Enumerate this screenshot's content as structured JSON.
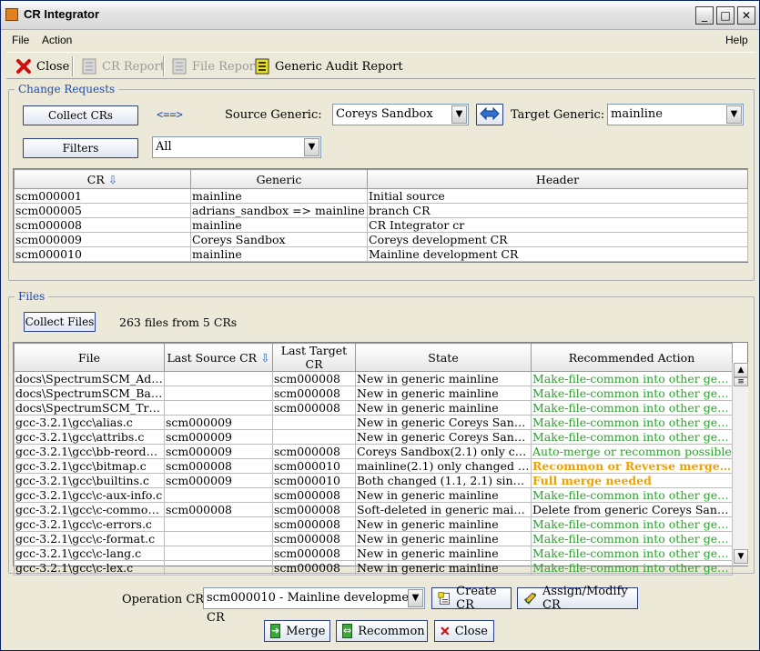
{
  "window": {
    "title": "CR Integrator"
  },
  "menu": {
    "file": "File",
    "action": "Action",
    "help": "Help"
  },
  "toolbar": {
    "close": "Close",
    "cr_report": "CR Report",
    "file_report": "File Report",
    "generic_audit": "Generic Audit Report"
  },
  "change_requests": {
    "legend": "Change Requests",
    "collect_btn": "Collect CRs",
    "arrows": "<==>",
    "source_label": "Source Generic:",
    "source_value": "Coreys Sandbox",
    "target_label": "Target Generic:",
    "target_value": "mainline",
    "filters_btn": "Filters",
    "filter_value": "All",
    "columns": [
      "CR",
      "Generic",
      "Header"
    ],
    "rows": [
      [
        "scm000001",
        "mainline",
        "Initial source"
      ],
      [
        "scm000005",
        "adrians_sandbox => mainline",
        "branch CR"
      ],
      [
        "scm000008",
        "mainline",
        "CR Integrator cr"
      ],
      [
        "scm000009",
        "Coreys Sandbox",
        "Coreys development CR"
      ],
      [
        "scm000010",
        "mainline",
        "Mainline development CR"
      ]
    ]
  },
  "files": {
    "legend": "Files",
    "collect_btn": "Collect Files",
    "summary": "263 files from 5 CRs",
    "columns": [
      "File",
      "Last Source CR",
      "Last Target CR",
      "State",
      "Recommended Action"
    ],
    "rows": [
      {
        "file": "docs\\SpectrumSCM_Adva...",
        "src": "",
        "tgt": "scm000008",
        "state": "New in generic mainline",
        "action": "Make-file-common into other generic",
        "color": "green"
      },
      {
        "file": "docs\\SpectrumSCM_Basic...",
        "src": "",
        "tgt": "scm000008",
        "state": "New in generic mainline",
        "action": "Make-file-common into other generic",
        "color": "green"
      },
      {
        "file": "docs\\SpectrumSCM_Traini...",
        "src": "",
        "tgt": "scm000008",
        "state": "New in generic mainline",
        "action": "Make-file-common into other generic",
        "color": "green"
      },
      {
        "file": "gcc-3.2.1\\gcc\\alias.c",
        "src": "scm000009",
        "tgt": "",
        "state": "New in generic Coreys Sandbox",
        "action": "Make-file-common into other generic",
        "color": "green"
      },
      {
        "file": "gcc-3.2.1\\gcc\\attribs.c",
        "src": "scm000009",
        "tgt": "",
        "state": "New in generic Coreys Sandbox",
        "action": "Make-file-common into other generic",
        "color": "green"
      },
      {
        "file": "gcc-3.2.1\\gcc\\bb-reorder.c",
        "src": "scm000009",
        "tgt": "scm000008",
        "state": "Coreys Sandbox(2.1) only chang...",
        "action": "Auto-merge or recommon possible",
        "color": "green"
      },
      {
        "file": "gcc-3.2.1\\gcc\\bitmap.c",
        "src": "scm000008",
        "tgt": "scm000010",
        "state": "mainline(2.1) only changed since ...",
        "action": "Recommon or Reverse merge nee...",
        "color": "orange"
      },
      {
        "file": "gcc-3.2.1\\gcc\\builtins.c",
        "src": "scm000009",
        "tgt": "scm000010",
        "state": "Both changed (1.1, 2.1) since 1.0",
        "action": "Full merge needed",
        "color": "orange"
      },
      {
        "file": "gcc-3.2.1\\gcc\\c-aux-info.c",
        "src": "",
        "tgt": "scm000008",
        "state": "New in generic mainline",
        "action": "Make-file-common into other generic",
        "color": "green"
      },
      {
        "file": "gcc-3.2.1\\gcc\\c-common.c",
        "src": "scm000008",
        "tgt": "scm000008",
        "state": "Soft-deleted in generic mainline",
        "action": "Delete from generic Coreys Sandbox",
        "color": "black"
      },
      {
        "file": "gcc-3.2.1\\gcc\\c-errors.c",
        "src": "",
        "tgt": "scm000008",
        "state": "New in generic mainline",
        "action": "Make-file-common into other generic",
        "color": "green"
      },
      {
        "file": "gcc-3.2.1\\gcc\\c-format.c",
        "src": "",
        "tgt": "scm000008",
        "state": "New in generic mainline",
        "action": "Make-file-common into other generic",
        "color": "green"
      },
      {
        "file": "gcc-3.2.1\\gcc\\c-lang.c",
        "src": "",
        "tgt": "scm000008",
        "state": "New in generic mainline",
        "action": "Make-file-common into other generic",
        "color": "green"
      },
      {
        "file": "gcc-3.2.1\\gcc\\c-lex.c",
        "src": "",
        "tgt": "scm000008",
        "state": "New in generic mainline",
        "action": "Make-file-common into other generic",
        "color": "green"
      }
    ]
  },
  "bottom": {
    "operation_label": "Operation CR:",
    "operation_value": "scm000010 - Mainline development CR",
    "create_cr": "Create CR",
    "assign_modify": "Assign/Modify CR",
    "merge": "Merge",
    "recommon": "Recommon",
    "close": "Close"
  }
}
